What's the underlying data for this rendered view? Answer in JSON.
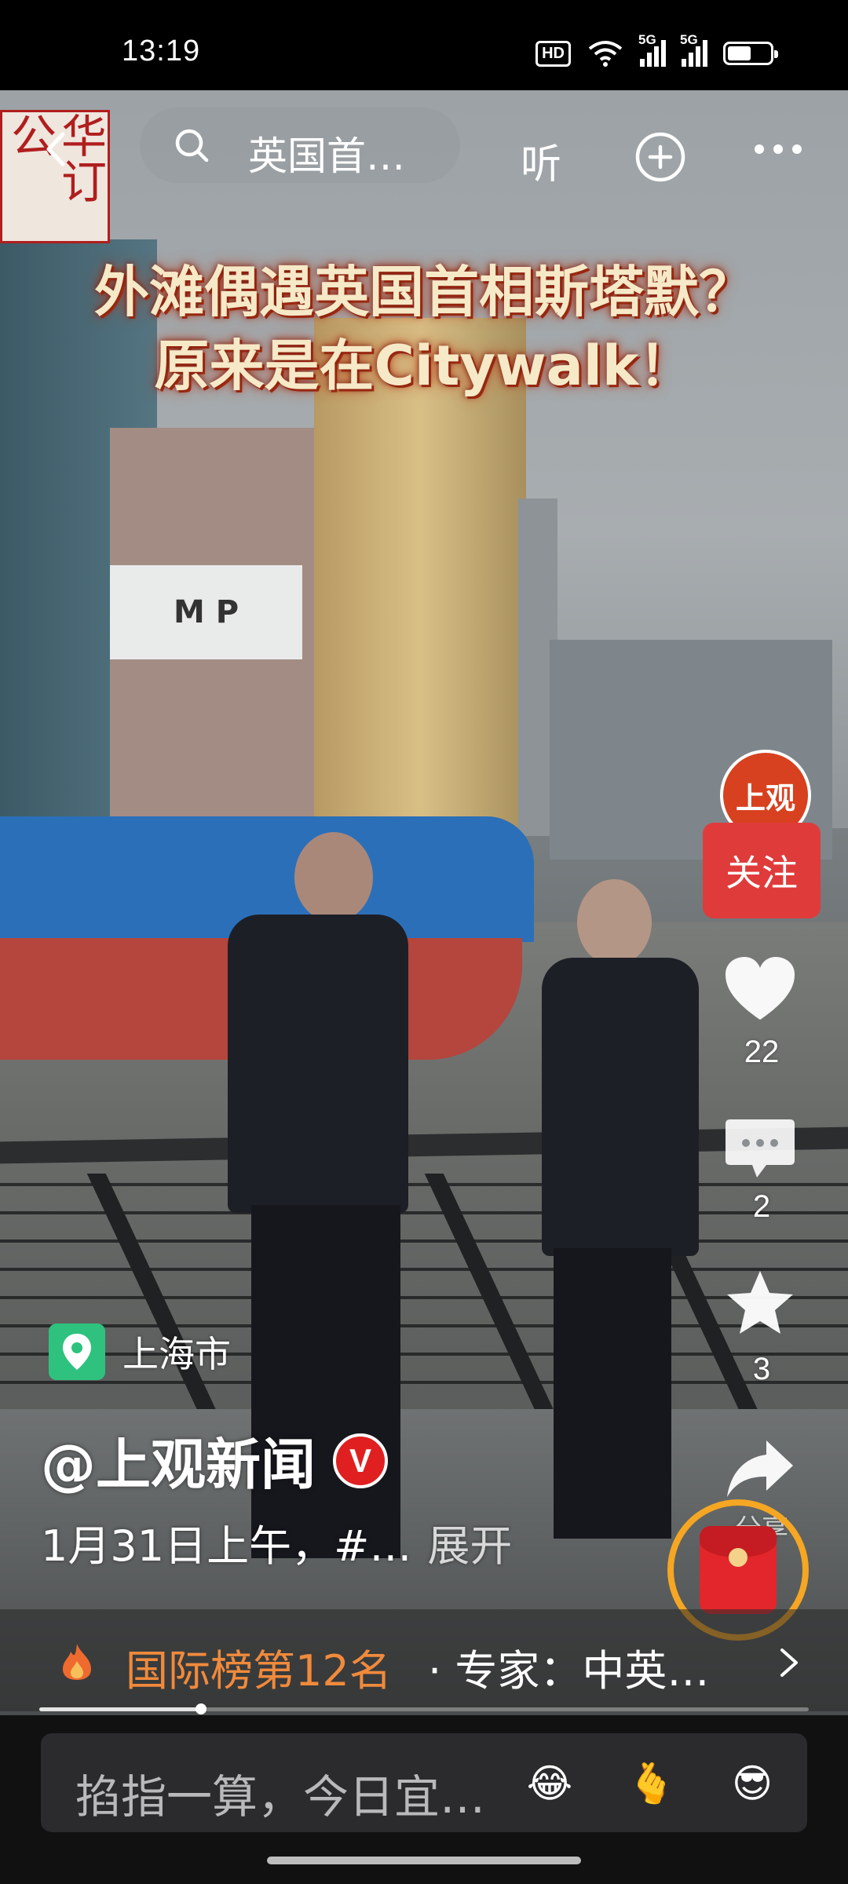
{
  "status_bar": {
    "time": "13:19",
    "hd_label": "HD",
    "network_1": "5G",
    "network_2": "5G",
    "battery_level": 0.55
  },
  "top_bar": {
    "search_text": "英国首…",
    "listen_label": "听",
    "icons": [
      "back-arrow-icon",
      "search-icon",
      "add-circle-icon",
      "more-icon"
    ]
  },
  "video": {
    "logo_text": "华订公",
    "title_line1": "外滩偶遇英国首相斯塔默？",
    "title_line2": "原来是在Citywalk！",
    "billboard_text": "M P"
  },
  "right_rail": {
    "avatar_text": "上观",
    "follow_label": "关注",
    "like_count": "22",
    "comment_count": "2",
    "favorite_count": "3",
    "share_label": "分享"
  },
  "info": {
    "location": "上海市",
    "author": "@上观新闻",
    "verified_mark": "V",
    "caption": "1月31日上午，#…",
    "expand_label": "展开"
  },
  "rank": {
    "rank_label": "国际榜第12名",
    "rank_sub": "· 专家：中英…",
    "progress": 0.21
  },
  "comment": {
    "placeholder": "掐指一算，今日宜…",
    "emojis": [
      "😂",
      "🫰",
      "😎"
    ]
  },
  "colors": {
    "accent_red": "#e03b3b",
    "rank_orange": "#f08a3c",
    "location_green": "#2ec27e",
    "hongbao_ring": "#f5a623"
  }
}
